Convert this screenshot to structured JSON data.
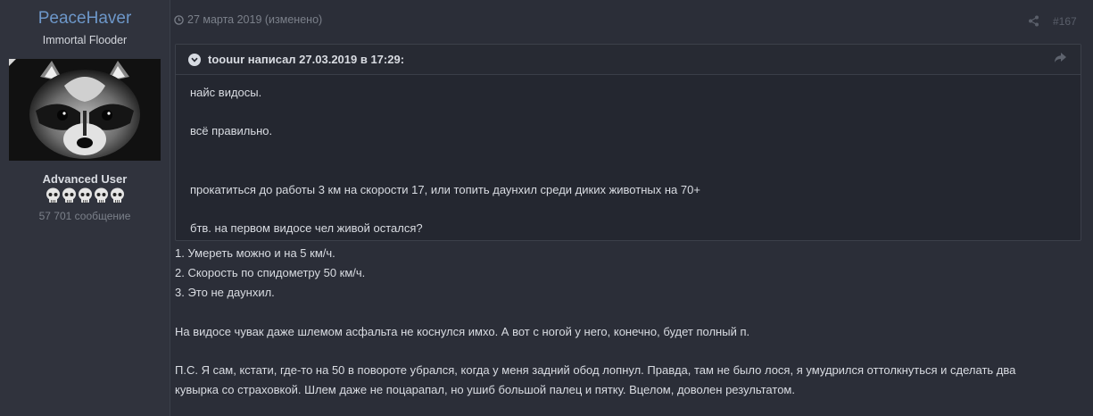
{
  "author": {
    "name": "PeaceHaver",
    "title": "Immortal Flooder",
    "rank": "Advanced User",
    "post_count": "57 701 сообщение",
    "rank_icons": [
      "skull-icon",
      "skull-icon",
      "skull-icon",
      "skull-icon",
      "skull-icon"
    ]
  },
  "post": {
    "date": "27 марта 2019 (изменено)",
    "number": "#167",
    "quote": {
      "citation": "toouur написал 27.03.2019 в 17:29:",
      "lines": [
        "найс видосы.",
        "всё правильно.",
        "прокатиться до работы 3 км на скорости 17, или топить даунхил среди диких животных на 70+",
        "бтв. на первом видосе чел живой остался?"
      ]
    },
    "body": [
      "1. Умереть можно и на 5 км/ч.",
      "2. Скорость по спидометру 50 км/ч.",
      "3. Это не даунхил.",
      "На видосе чувак даже шлемом асфальта не коснулся имхо. А вот с ногой у него, конечно, будет полный п.",
      "П.С. Я сам, кстати, где-то на 50 в повороте убрался, когда у меня задний обод лопнул. Правда, там не было лося, я умудрился оттолкнуться и сделать два",
      "кувырка со страховкой. Шлем даже не поцарапал, но ушиб большой палец и пятку. Вцелом, доволен результатом."
    ]
  },
  "icons": {
    "clock": "clock-icon",
    "share": "share-icon",
    "quote_toggle": "chevron-down-icon",
    "quote_jump": "reply-arrow-icon",
    "avatar": "raccoon-avatar"
  },
  "colors": {
    "background": "#2b2e38",
    "author_column": "#30333d",
    "username": "#6d97c9",
    "quote_background": "#242730",
    "muted_text": "#7b808a"
  }
}
